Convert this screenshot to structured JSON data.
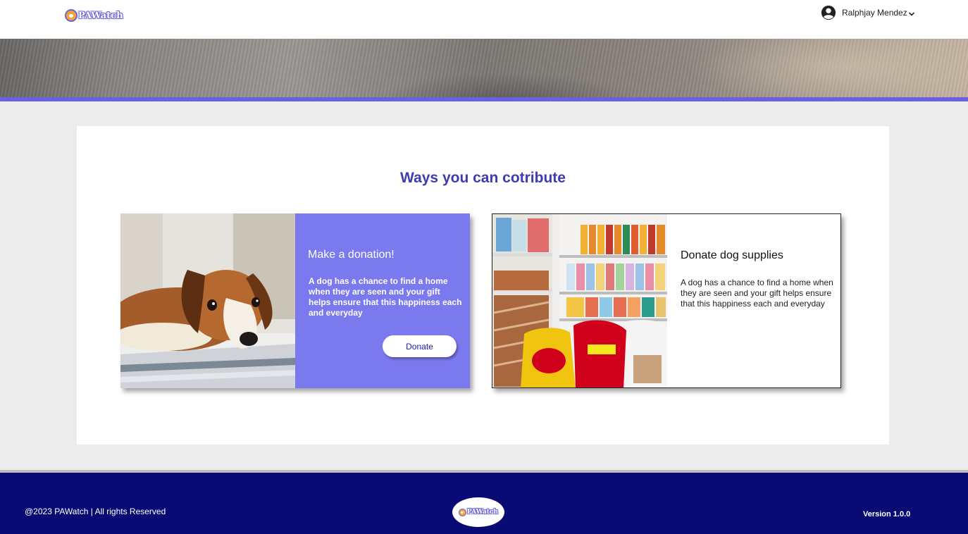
{
  "header": {
    "logo_text": "PAWatch",
    "user_name": "Ralphjay Mendez"
  },
  "main": {
    "title": "Ways you can cotribute",
    "cards": [
      {
        "heading": "Make a donation!",
        "text": "A dog has a chance to find a home when they are seen and your gift helps ensure that this happiness each and everyday",
        "button_label": "Donate",
        "image": "sad-puppy-photo",
        "background": "#7b79ee"
      },
      {
        "heading": "Donate dog supplies",
        "text": "A dog has a chance to find a home when they are seen and your gift helps ensure that this happiness each and everyday",
        "image": "pet-store-shelves-photo",
        "background": "#ffffff"
      }
    ]
  },
  "footer": {
    "copyright": "@2023 PAWatch | All rights Reserved",
    "logo_text": "PAWatch",
    "version": "Version 1.0.0"
  },
  "colors": {
    "accent": "#6a62dd",
    "title": "#3d3cb0",
    "footer_bg": "#0a0a74"
  }
}
